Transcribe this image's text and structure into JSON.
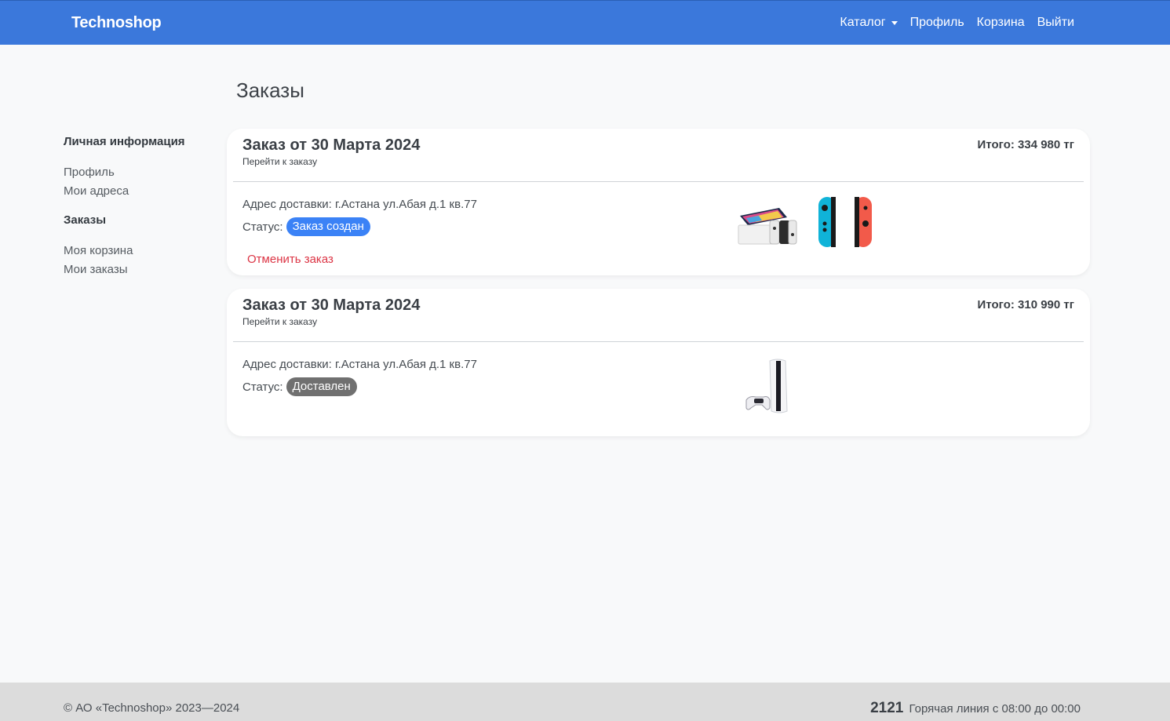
{
  "header": {
    "brand": "Technoshop",
    "nav": {
      "catalog": "Каталог",
      "profile": "Профиль",
      "cart": "Корзина",
      "logout": "Выйти"
    }
  },
  "page": {
    "title": "Заказы"
  },
  "sidebar": {
    "personal_heading": "Личная информация",
    "profile": "Профиль",
    "addresses": "Мои адреса",
    "orders_heading": "Заказы",
    "my_cart": "Моя корзина",
    "my_orders": "Мои заказы"
  },
  "orders": [
    {
      "title": "Заказ от 30 Марта 2024",
      "link": "Перейти к заказу",
      "total": "Итого: 334 980 тг",
      "address": "Адрес доставки: г.Астана ул.Абая д.1 кв.77",
      "status_label": "Статус:",
      "status": "Заказ создан",
      "status_color": "#3b82f6",
      "cancel": "Отменить заказ",
      "products": [
        "nintendo-switch-oled",
        "joy-con-pair"
      ]
    },
    {
      "title": "Заказ от 30 Марта 2024",
      "link": "Перейти к заказу",
      "total": "Итого: 310 990 тг",
      "address": "Адрес доставки: г.Астана ул.Абая д.1 кв.77",
      "status_label": "Статус:",
      "status": "Доставлен",
      "status_color": "#707070",
      "products": [
        "playstation-5"
      ]
    }
  ],
  "footer": {
    "copyright": "© АО «Technoshop» 2023—2024",
    "hotline_number": "2121",
    "hotline_text": "Горячая линия с 08:00 до 00:00"
  }
}
